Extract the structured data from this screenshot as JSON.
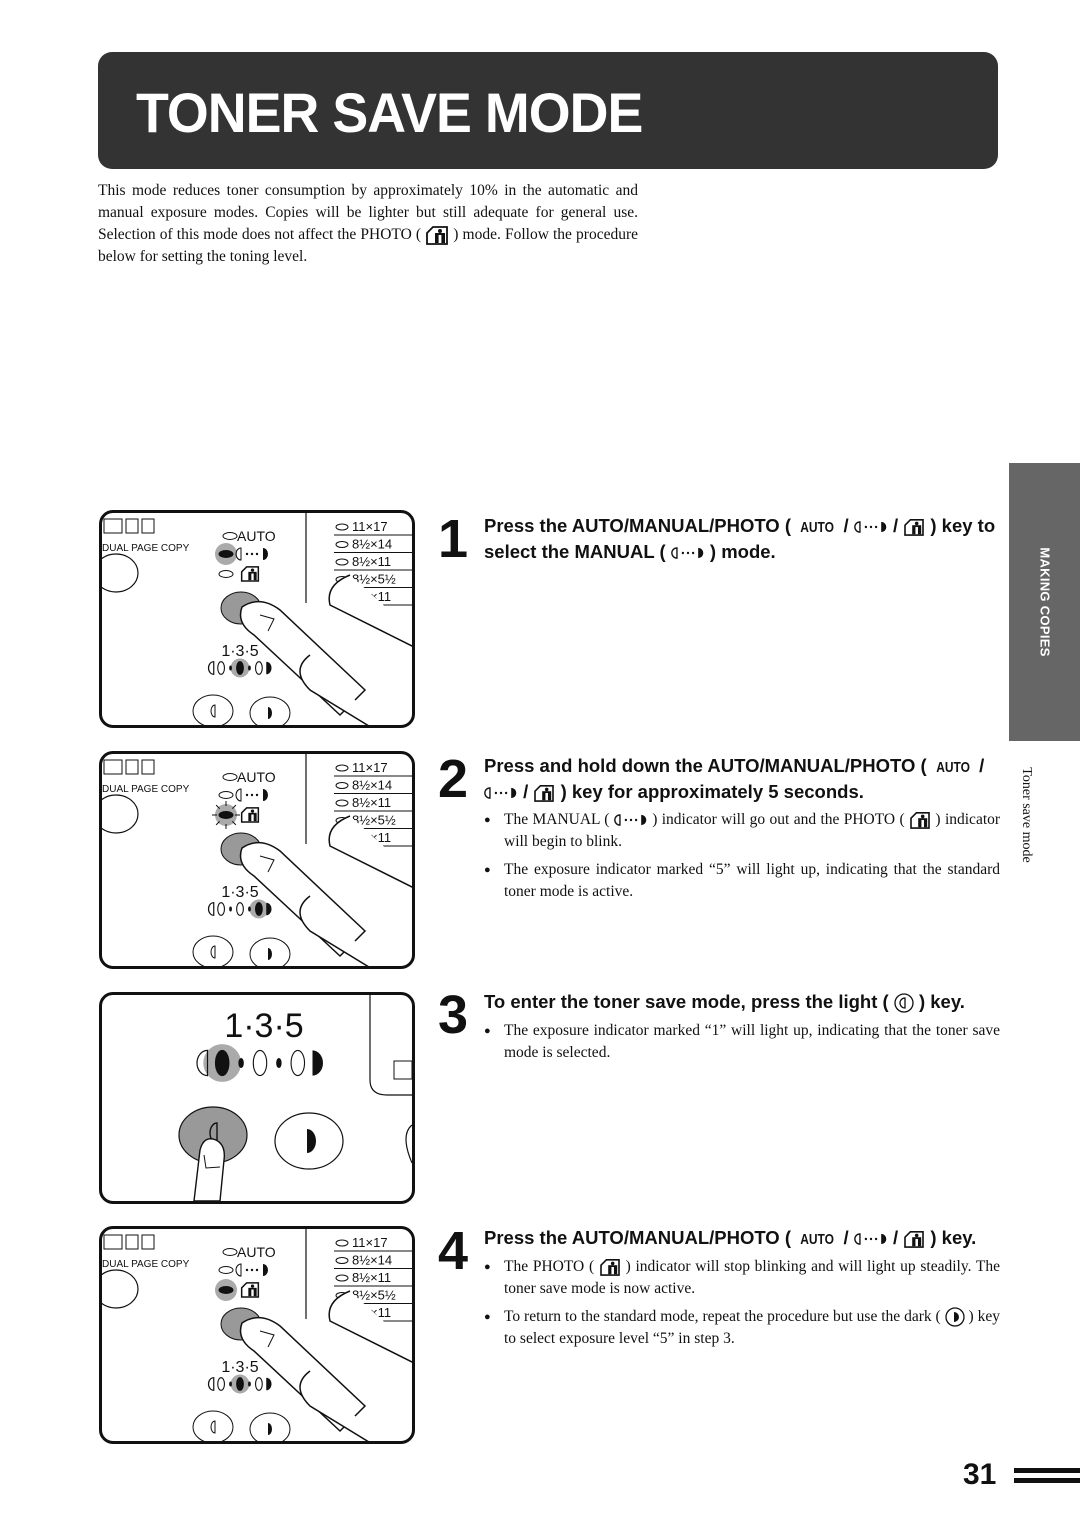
{
  "header": {
    "title": "TONER SAVE MODE"
  },
  "intro": {
    "line_before_icon": "This mode reduces toner consumption by approximately 10% in the automatic and manual exposure modes. Copies will be lighter but still adequate for general use. Selection of this mode does not affect the PHOTO (",
    "icon": "photo-icon",
    "line_after_icon": ") mode. Follow the procedure below for setting the toning level."
  },
  "side_tab": {
    "section": "MAKING COPIES",
    "subsection": "Toner save mode"
  },
  "icons": {
    "auto_label": "AUTO",
    "manual": "manual-exposure-icon",
    "photo": "photo-icon",
    "light_key": "light-key-icon",
    "dark_key": "dark-key-icon"
  },
  "panel": {
    "dual_page_copy": "DUAL PAGE COPY",
    "auto": "AUTO",
    "exposure_scale": "1·3·5",
    "paper_sizes": [
      "11×17",
      "8½×14",
      "8½×11",
      "8½×5½",
      "8½×11"
    ]
  },
  "steps": [
    {
      "number": "1",
      "heading_a": "Press the AUTO/MANUAL/PHOTO (",
      "heading_b": ") key to select the MANUAL (",
      "heading_c": ") mode.",
      "bullets": [],
      "panel_state": {
        "manual_lit": true,
        "photo_state": "off",
        "exposure_level": 3
      }
    },
    {
      "number": "2",
      "heading_a": "Press and hold down the AUTO/MANUAL/PHOTO (",
      "heading_b": ") key for approximately 5 seconds.",
      "bullets": [
        {
          "a": "The MANUAL (",
          "b": ") indicator will go out and the PHOTO (",
          "c": ") indicator will begin to blink."
        },
        {
          "text": "The exposure indicator marked “5” will light up, indicating that the standard toner mode is active."
        }
      ],
      "panel_state": {
        "manual_lit": false,
        "photo_state": "blinking",
        "exposure_level": 5
      }
    },
    {
      "number": "3",
      "heading_a": "To enter the toner save mode, press the light (",
      "heading_b": ") key.",
      "bullets": [
        {
          "text": "The exposure indicator marked “1” will light up, indicating that the toner save mode is selected."
        }
      ],
      "panel_state": {
        "exposure_level": 1
      }
    },
    {
      "number": "4",
      "heading_a": "Press the AUTO/MANUAL/PHOTO (",
      "heading_b": ") key.",
      "bullets": [
        {
          "a": "The PHOTO (",
          "b": ") indicator will stop blinking and will light up steadily. The toner save mode is now active."
        },
        {
          "a": "To return to the standard mode, repeat the procedure but use the dark (",
          "b": ") key to select exposure level “5” in step 3."
        }
      ],
      "panel_state": {
        "manual_lit": false,
        "photo_state": "on",
        "exposure_level": 3
      }
    }
  ],
  "footer": {
    "page_number": "31"
  }
}
